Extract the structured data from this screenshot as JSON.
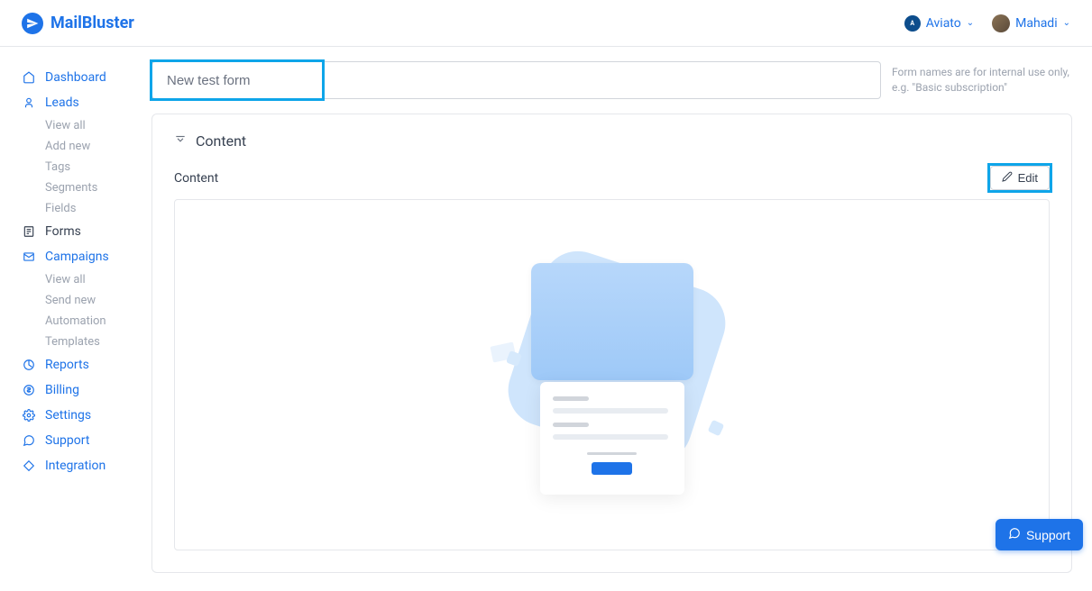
{
  "brand": "MailBluster",
  "header": {
    "org": "Aviato",
    "user": "Mahadi"
  },
  "sidebar": {
    "dashboard": "Dashboard",
    "leads": {
      "label": "Leads",
      "items": [
        "View all",
        "Add new",
        "Tags",
        "Segments",
        "Fields"
      ]
    },
    "forms": "Forms",
    "campaigns": {
      "label": "Campaigns",
      "items": [
        "View all",
        "Send new",
        "Automation",
        "Templates"
      ]
    },
    "reports": "Reports",
    "billing": "Billing",
    "settings": "Settings",
    "support": "Support",
    "integration": "Integration"
  },
  "form": {
    "name_value": "New test form",
    "name_hint": "Form names are for internal use only, e.g. \"Basic subscription\""
  },
  "panel": {
    "title": "Content",
    "content_label": "Content",
    "edit_label": "Edit"
  },
  "fab": {
    "support": "Support"
  }
}
